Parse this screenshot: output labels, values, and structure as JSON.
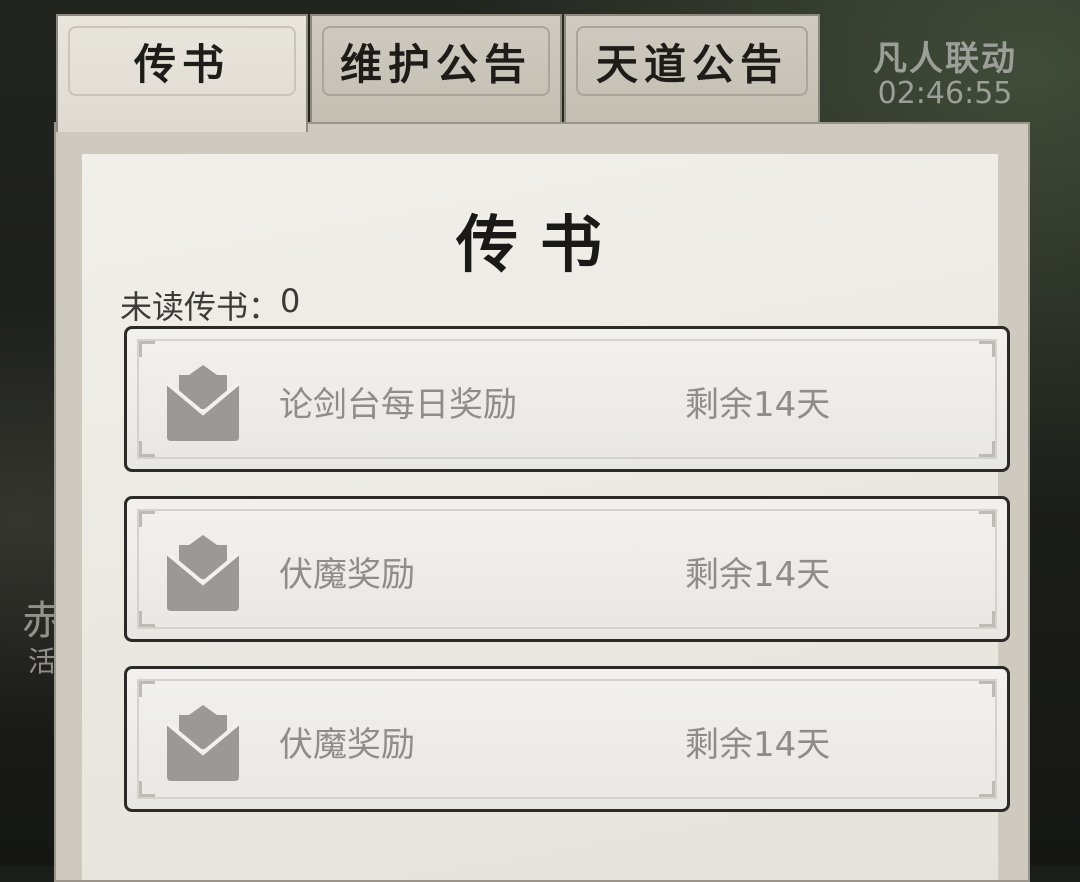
{
  "tabs": [
    {
      "label": "传书",
      "active": true
    },
    {
      "label": "维护公告",
      "active": false
    },
    {
      "label": "天道公告",
      "active": false
    }
  ],
  "event": {
    "name": "凡人联动",
    "countdown": "02:46:55"
  },
  "panel": {
    "title": "传书",
    "unread_label": "未读传书：",
    "unread_count": "0"
  },
  "mails": [
    {
      "name": "论剑台每日奖励",
      "remaining": "剩余14天",
      "icon": "envelope-icon"
    },
    {
      "name": "伏魔奖励",
      "remaining": "剩余14天",
      "icon": "envelope-icon"
    },
    {
      "name": "伏魔奖励",
      "remaining": "剩余14天",
      "icon": "envelope-icon"
    }
  ],
  "background_fragments": [
    "赤",
    "活"
  ],
  "colors": {
    "panel": "#e6e3dc",
    "mail_text": "#8e8d8a",
    "icon_gray": "#9a9996"
  }
}
